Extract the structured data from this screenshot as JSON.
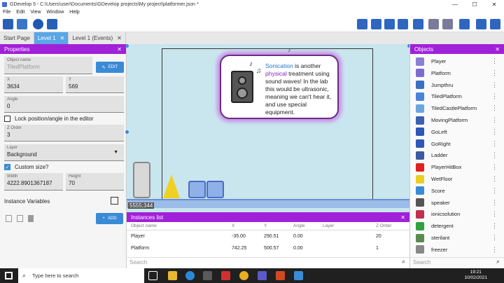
{
  "titlebar": {
    "title": "GDevelop 5 - C:\\Users\\user\\Documents\\GDevelop projects\\My project\\platformer.json *",
    "minimize": "—",
    "maximize": "☐",
    "close": "✕"
  },
  "menu": [
    "File",
    "Edit",
    "View",
    "Window",
    "Help"
  ],
  "tabs": [
    {
      "label": "Start Page",
      "active": false
    },
    {
      "label": "Level 1",
      "active": true,
      "close": "✕"
    },
    {
      "label": "Level 1 (Events)",
      "active": false,
      "close": "✕"
    }
  ],
  "properties": {
    "header": "Properties",
    "close": "✕",
    "object_name_label": "Object name",
    "object_name": "TiledPlatform",
    "edit_label": "EDIT",
    "x_label": "X",
    "x": "3634",
    "y_label": "Y",
    "y": "569",
    "angle_label": "Angle",
    "angle": "0",
    "lock_label": "Lock position/angle in the editor",
    "zorder_label": "Z Order",
    "zorder": "3",
    "layer_label": "Layer",
    "layer": "Background",
    "custom_size_label": "Custom size?",
    "width_label": "Width",
    "width": "4222.8901367187",
    "height_label": "Height",
    "height": "70",
    "instance_vars_label": "Instance Variables",
    "add_label": "ADD"
  },
  "scene": {
    "speech_parts": {
      "p1": "Sonication",
      "p2": " is another ",
      "p3": "physical",
      "p4": " treatment using sound waves! In the lab this would be ultrasonic, meaning we can't hear it, and use special equipment."
    },
    "coords": "5555;344"
  },
  "instances": {
    "header": "Instances list",
    "close": "✕",
    "columns": [
      "Object name",
      "X",
      "Y",
      "Angle",
      "Layer",
      "Z Order"
    ],
    "rows": [
      [
        "Player",
        "-35.00",
        "290.51",
        "0.00",
        "",
        "20"
      ],
      [
        "Platform",
        "742.25",
        "500.57",
        "0.00",
        "",
        "1"
      ]
    ],
    "search_placeholder": "Search"
  },
  "objects": {
    "header": "Objects",
    "close": "✕",
    "items": [
      {
        "name": "Player",
        "color": "#8a7fd6"
      },
      {
        "name": "Platform",
        "color": "#7b6cd0"
      },
      {
        "name": "Jumpthru",
        "color": "#3a6fc4"
      },
      {
        "name": "TiledPlatform",
        "color": "#4a84d8"
      },
      {
        "name": "TiledCastlePlatform",
        "color": "#6aa7e0"
      },
      {
        "name": "MovingPlatform",
        "color": "#3a62b0"
      },
      {
        "name": "GoLeft",
        "color": "#2d57b8"
      },
      {
        "name": "GoRight",
        "color": "#2d57b8"
      },
      {
        "name": "Ladder",
        "color": "#3d5aa0"
      },
      {
        "name": "PlayerHitBox",
        "color": "#e02020"
      },
      {
        "name": "WetFloor",
        "color": "#e8d020"
      },
      {
        "name": "Score",
        "color": "#3a8bd6"
      },
      {
        "name": "speaker",
        "color": "#555555"
      },
      {
        "name": "ionicsolution",
        "color": "#c03050"
      },
      {
        "name": "detergent",
        "color": "#30a040"
      },
      {
        "name": "sterilant",
        "color": "#5a8a50"
      },
      {
        "name": "freezer",
        "color": "#888888"
      }
    ],
    "search_placeholder": "Search"
  },
  "taskbar": {
    "search_placeholder": "Type here to search",
    "time": "19:21",
    "date": "10/02/2021"
  }
}
